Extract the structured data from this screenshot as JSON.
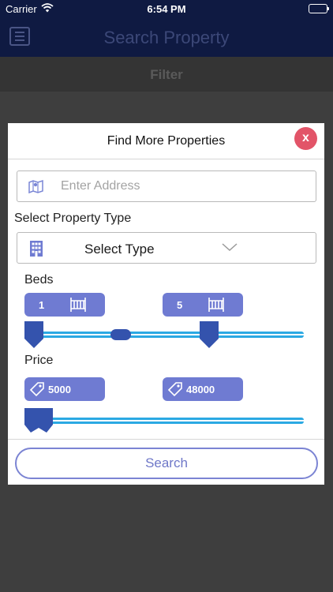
{
  "status_bar": {
    "carrier": "Carrier",
    "time": "6:54 PM"
  },
  "nav": {
    "title": "Search Property",
    "menu_icon": "hamburger-menu-icon"
  },
  "filter_bar": {
    "title": "Filter"
  },
  "modal": {
    "title": "Find More Properties",
    "close_label": "x",
    "address": {
      "placeholder": "Enter Address",
      "value": "",
      "icon": "map-icon"
    },
    "property_type": {
      "label": "Select Property Type",
      "selected": "Select Type",
      "icon": "building-icon"
    },
    "beds": {
      "label": "Beds",
      "min": "1",
      "max": "5",
      "icon": "crib-icon"
    },
    "price": {
      "label": "Price",
      "min": "5000",
      "max": "48000",
      "icon": "price-tag-icon"
    },
    "search_label": "Search"
  },
  "colors": {
    "nav_bg": "#0f1a42",
    "accent": "#6f7bd2",
    "close": "#e25468",
    "slider": "#2ba9e3",
    "handle": "#3453ad"
  }
}
